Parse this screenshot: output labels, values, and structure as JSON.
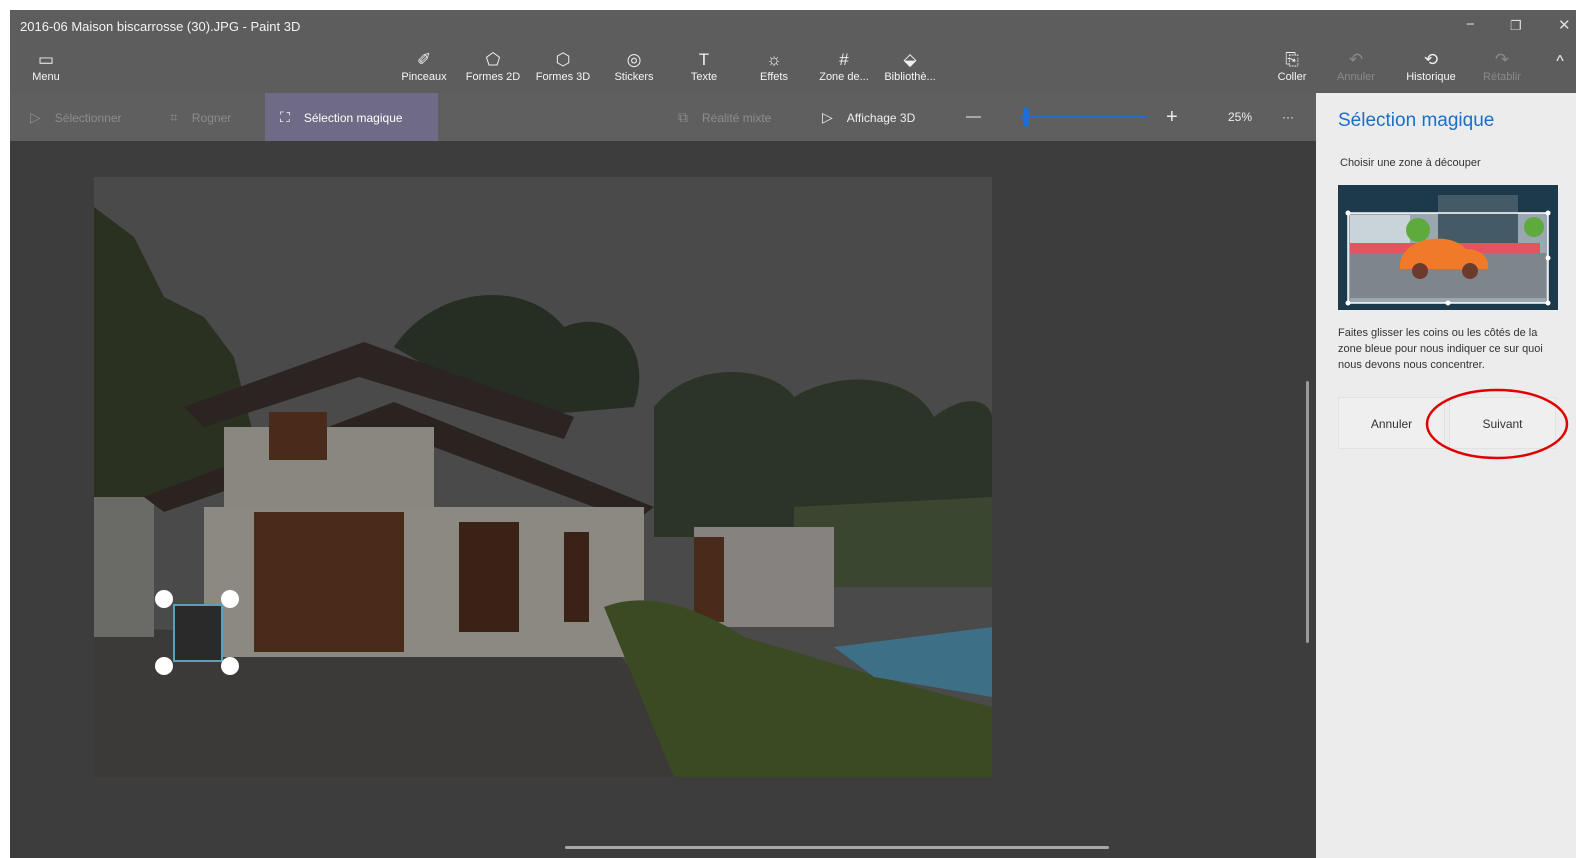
{
  "window": {
    "title": "2016-06 Maison biscarrosse (30).JPG - Paint 3D",
    "controls": {
      "minimize": "−",
      "maximize": "❐",
      "close": "✕"
    }
  },
  "toolbar": {
    "menu_label": "Menu",
    "tools": [
      {
        "label": "Pinceaux",
        "icon": "brush-icon"
      },
      {
        "label": "Formes 2D",
        "icon": "shapes-2d-icon"
      },
      {
        "label": "Formes 3D",
        "icon": "shapes-3d-icon"
      },
      {
        "label": "Stickers",
        "icon": "stickers-icon"
      },
      {
        "label": "Texte",
        "icon": "text-icon"
      },
      {
        "label": "Effets",
        "icon": "effects-icon"
      },
      {
        "label": "Zone de...",
        "icon": "canvas-icon"
      },
      {
        "label": "Bibliothè...",
        "icon": "library-icon"
      }
    ],
    "paste_label": "Coller",
    "undo_label": "Annuler",
    "history_label": "Historique",
    "redo_label": "Rétablir",
    "collapse_glyph": "^"
  },
  "subtoolbar": {
    "select_label": "Sélectionner",
    "crop_label": "Rogner",
    "magic_select_label": "Sélection magique",
    "mixed_reality_label": "Réalité mixte",
    "view3d_label": "Affichage 3D",
    "zoom_minus": "—",
    "zoom_plus": "+",
    "zoom_level": "25%",
    "zoom_fraction": 0.05,
    "more_label": "···"
  },
  "panel": {
    "title": "Sélection magique",
    "subtitle": "Choisir une zone à découper",
    "description": "Faites glisser les coins ou les côtés de la zone bleue pour nous indiquer ce sur quoi nous devons nous concentrer.",
    "cancel_label": "Annuler",
    "next_label": "Suivant"
  },
  "colors": {
    "accent": "#1a6fc9",
    "annotation": "#e00000"
  }
}
